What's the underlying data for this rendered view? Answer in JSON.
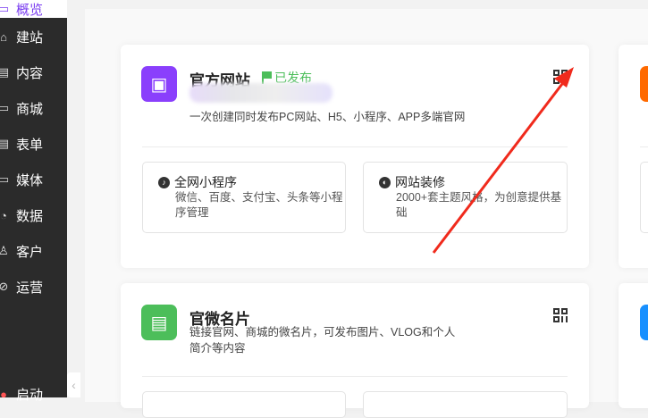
{
  "sidebar": {
    "active": "概览",
    "items": [
      {
        "label": "建站",
        "icon": "home-icon"
      },
      {
        "label": "内容",
        "icon": "document-icon"
      },
      {
        "label": "商城",
        "icon": "cart-icon"
      },
      {
        "label": "表单",
        "icon": "form-icon"
      },
      {
        "label": "媒体",
        "icon": "media-icon"
      },
      {
        "label": "数据",
        "icon": "chart-icon"
      },
      {
        "label": "客户",
        "icon": "user-icon"
      },
      {
        "label": "运营",
        "icon": "paperclip-icon"
      }
    ],
    "bottom": "启动"
  },
  "cards": [
    {
      "title": "官方网站",
      "status": "已发布",
      "desc": "一次创建同时发布PC网站、H5、小程序、APP多端官网",
      "color": "#8a3ffc",
      "subs": [
        {
          "title": "全网小程序",
          "desc": "微信、百度、支付宝、头条等小程序管理"
        },
        {
          "title": "网站装修",
          "desc": "2000+套主题风格，为创意提供基础"
        }
      ]
    },
    {
      "title": "官微名片",
      "desc": "链接官网、商城的微名片，可发布图片、VLOG和个人简介等内容",
      "color": "#4cbe5a"
    }
  ],
  "colors": {
    "accent": "#7a3cf0",
    "arrow": "#f02a1c",
    "orange": "#ff6a00",
    "blue": "#1890ff"
  }
}
